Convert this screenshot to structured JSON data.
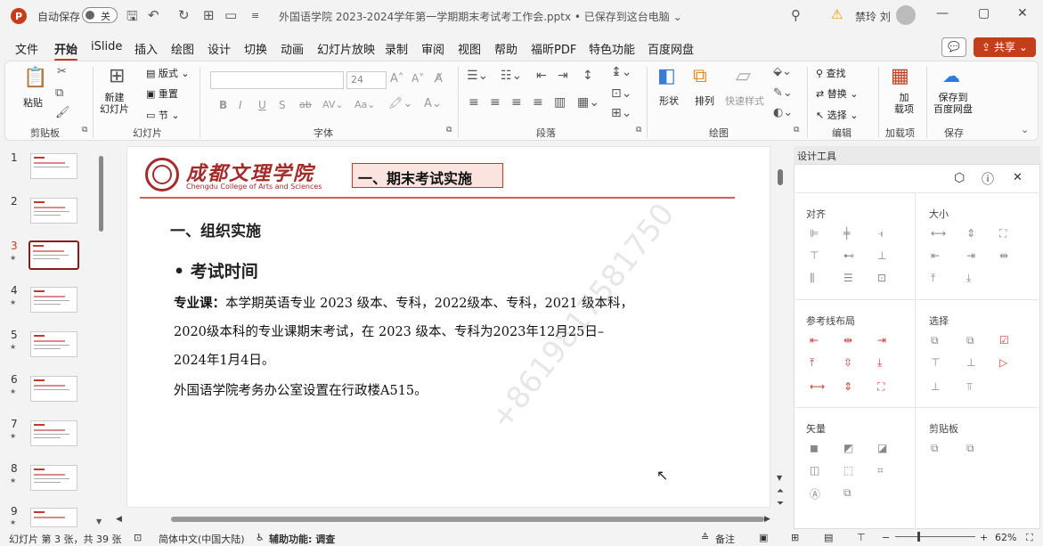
{
  "titlebar": {
    "app_logo": "P",
    "autosave_label": "自动保存",
    "autosave_state": "关",
    "doc_title": "外国语学院 2023-2024学年第一学期期末考试考工作会.pptx • 已保存到这台电脑 ⌄",
    "user_name": "禁玲 刘",
    "icons": [
      "save-icon",
      "undo-icon",
      "redo-icon",
      "present-icon",
      "folder-icon",
      "customize-icon"
    ]
  },
  "menu": {
    "tabs": [
      "文件",
      "开始",
      "iSlide",
      "插入",
      "绘图",
      "设计",
      "切换",
      "动画",
      "幻灯片放映",
      "录制",
      "审阅",
      "视图",
      "帮助",
      "福昕PDF",
      "特色功能",
      "百度网盘"
    ],
    "active": "开始",
    "share_label": "共享"
  },
  "ribbon": {
    "clipboard": {
      "paste": "粘贴",
      "label": "剪贴板"
    },
    "slides": {
      "new_slide": "新建\n幻灯片",
      "layout": "版式",
      "reset": "重置",
      "section": "节",
      "label": "幻灯片"
    },
    "font": {
      "size": "24",
      "label": "字体"
    },
    "paragraph": {
      "label": "段落"
    },
    "drawing": {
      "shape": "形状",
      "arrange": "排列",
      "quick_style": "快速样式",
      "label": "绘图"
    },
    "editing": {
      "find": "查找",
      "replace": "替换",
      "select": "选择",
      "label": "编辑"
    },
    "addins": {
      "addin": "加\n载项",
      "label": "加载项"
    },
    "save": {
      "save_baidu": "保存到\n百度网盘",
      "label": "保存"
    }
  },
  "thumbnails": [
    {
      "num": "1"
    },
    {
      "num": "2"
    },
    {
      "num": "3"
    },
    {
      "num": "4"
    },
    {
      "num": "5"
    },
    {
      "num": "6"
    },
    {
      "num": "7"
    },
    {
      "num": "8"
    },
    {
      "num": "9"
    }
  ],
  "slide": {
    "logo_cn": "成都文理学院",
    "logo_en": "Chengdu College of Arts and Sciences",
    "title_box": "一、期末考试实施",
    "heading1": "一、组织实施",
    "heading2": "• 考试时间",
    "body_lead": "专业课：",
    "body_line1": "本学期英语专业 2023 级本、专科，2022级本、专科，2021 级本科，",
    "body_line2": "2020级本科的专业课期末考试，在 2023 级本、专科为2023年12月25日–",
    "body_line3": "2024年1月4日。",
    "body_line4": "外国语学院考务办公室设置在行政楼A515。",
    "watermark": "+8619817581750"
  },
  "pane": {
    "header": "设计工具",
    "align": "对齐",
    "size": "大小",
    "guide_layout": "参考线布局",
    "select": "选择",
    "vector": "矢量",
    "clipboard": "剪贴板"
  },
  "status": {
    "slide_info": "幻灯片 第 3 张，共 39 张",
    "language": "简体中文(中国大陆)",
    "accessibility": "辅助功能: 调查",
    "notes": "备注",
    "zoom": "62%"
  }
}
